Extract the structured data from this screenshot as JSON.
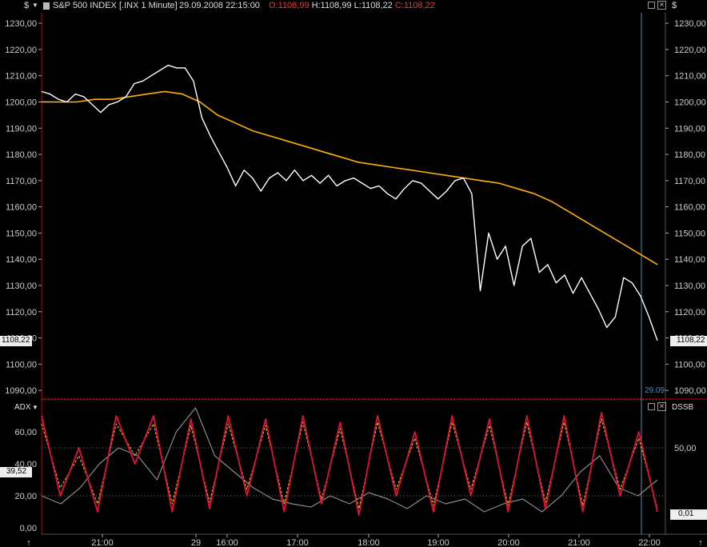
{
  "header": {
    "currency_left": "$",
    "currency_right": "$",
    "instrument": "S&P 500 INDEX [.INX  1 Minute]",
    "datetime": "29.09.2008 22:15:00",
    "open_label": "O:",
    "open_value": "1108,99",
    "high_label": "H:",
    "high_value": "1108,99",
    "low_label": "L:",
    "low_value": "1108,22",
    "close_label": "C:",
    "close_value": "1108,22"
  },
  "price_axis": {
    "ticks": [
      "1230,00",
      "1220,00",
      "1210,00",
      "1200,00",
      "1190,00",
      "1180,00",
      "1170,00",
      "1160,00",
      "1150,00",
      "1140,00",
      "1130,00",
      "1120,00",
      "1110,00",
      "1100,00",
      "1090,00"
    ],
    "last_price_left": "1108,22",
    "last_price_right": "1108,22",
    "cursor_date": "29.09"
  },
  "oscillator": {
    "name_left": "ADX",
    "name_right": "DSSB",
    "ticks_left": [
      "60,00",
      "40,00",
      "20,00",
      "0,00"
    ],
    "tick_right": "50,00",
    "adx_value": "39,52",
    "dssb_value": "0,01"
  },
  "time_axis": {
    "ticks": [
      "21:00",
      "29",
      "16:00",
      "17:00",
      "18:00",
      "19:00",
      "20:00",
      "21:00",
      "22:00"
    ]
  },
  "colors": {
    "price": "#ffffff",
    "moving_average": "#ffb000",
    "oscillator_main": "#e0103a",
    "oscillator_signal": "#e8d020",
    "adx_line": "#8a8a8a",
    "open_value": "#ff3030",
    "close_value": "#ff3030",
    "panel_border": "#c00000",
    "cursor_line": "#5a8aa8"
  },
  "chart_data": [
    {
      "type": "line",
      "title": "S&P 500 INDEX [.INX  1 Minute]",
      "ylim": [
        1087,
        1234
      ],
      "x_ticks": [
        "21:00",
        "29",
        "16:00",
        "17:00",
        "18:00",
        "19:00",
        "20:00",
        "21:00",
        "22:00"
      ],
      "series": [
        {
          "values": [
            1204,
            1203,
            1201,
            1200,
            1203,
            1202,
            1199,
            1196,
            1199,
            1200,
            1202,
            1207,
            1208,
            1210,
            1212,
            1214,
            1213,
            1213,
            1208,
            1194,
            1187,
            1181,
            1175,
            1168,
            1174,
            1171,
            1166,
            1171,
            1173,
            1170,
            1174,
            1170,
            1172,
            1169,
            1172,
            1168,
            1170,
            1171,
            1169,
            1167,
            1168,
            1165,
            1163,
            1167,
            1170,
            1169,
            1166,
            1163,
            1166,
            1170,
            1171,
            1165,
            1128,
            1150,
            1140,
            1145,
            1130,
            1145,
            1148,
            1135,
            1138,
            1131,
            1134,
            1127,
            1133,
            1127,
            1121,
            1114,
            1118,
            1133,
            1131,
            1126,
            1118,
            1109
          ]
        },
        {
          "values": [
            1200,
            1200,
            1200,
            1201,
            1201,
            1202,
            1203,
            1204,
            1203,
            1200,
            1195,
            1192,
            1189,
            1187,
            1185,
            1183,
            1181,
            1179,
            1177,
            1176,
            1175,
            1174,
            1173,
            1172,
            1171,
            1170,
            1169,
            1167,
            1165,
            1162,
            1158,
            1154,
            1150,
            1146,
            1142,
            1138
          ]
        }
      ]
    },
    {
      "type": "line",
      "ylim": [
        -4,
        80
      ],
      "y_ticks": [
        "60,00",
        "40,00",
        "20,00",
        "0,00"
      ],
      "series": [
        {
          "values": [
            70,
            20,
            50,
            10,
            70,
            40,
            70,
            10,
            68,
            12,
            70,
            20,
            68,
            10,
            70,
            15,
            66,
            8,
            70,
            20,
            60,
            10,
            70,
            20,
            68,
            10,
            70,
            12,
            70,
            10,
            72,
            20,
            60,
            10
          ]
        },
        {
          "values": [
            65,
            25,
            45,
            15,
            65,
            45,
            65,
            15,
            64,
            16,
            65,
            24,
            64,
            15,
            66,
            18,
            62,
            12,
            66,
            24,
            56,
            14,
            66,
            24,
            64,
            14,
            66,
            16,
            66,
            14,
            68,
            24,
            56,
            12
          ]
        },
        {
          "values": [
            20,
            15,
            25,
            40,
            50,
            45,
            30,
            60,
            75,
            45,
            35,
            25,
            18,
            15,
            13,
            20,
            15,
            22,
            18,
            12,
            20,
            15,
            18,
            10,
            15,
            18,
            10,
            20,
            35,
            45,
            25,
            20,
            30
          ]
        }
      ]
    }
  ]
}
